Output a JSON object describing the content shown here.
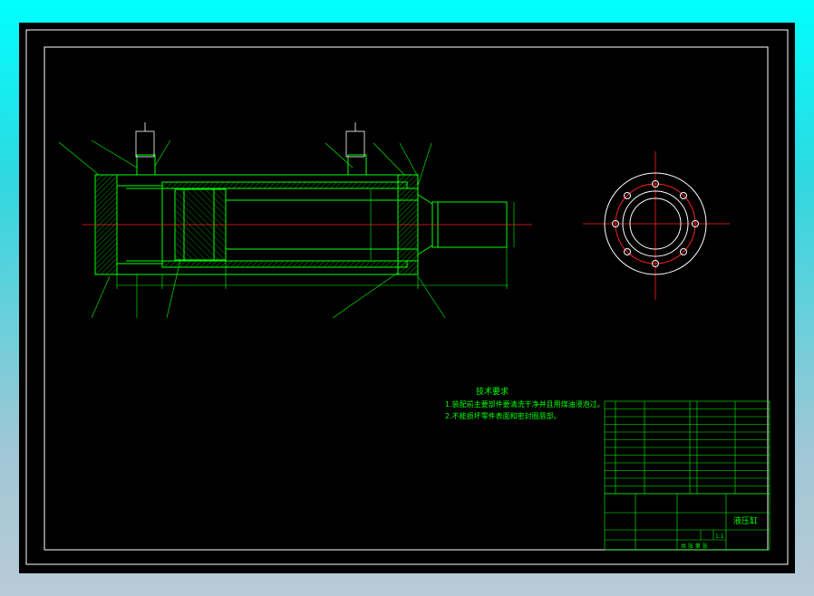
{
  "drawing": {
    "title": "液压缸",
    "tech_requirements": {
      "heading": "技术要求",
      "items": [
        "1.装配前主要部件要清洗干净并且用煤油浸泡过。",
        "2.不能损坏零件表面和密封圈唇部。"
      ]
    },
    "title_block": {
      "scale": "1:1",
      "sheet_note": "共 张 第 张",
      "labels": [
        "标记",
        "处数",
        "分区",
        "更改文件号",
        "签名",
        "日期",
        "设计",
        "审核",
        "工艺",
        "批准",
        "阶段标记",
        "重量",
        "比例"
      ]
    },
    "colors": {
      "background": "#000000",
      "frame": "#ffffff",
      "part": "#00ff00",
      "centerline": "#ff2020",
      "dimension": "#00ff00",
      "bolt": "#ffffff"
    }
  }
}
